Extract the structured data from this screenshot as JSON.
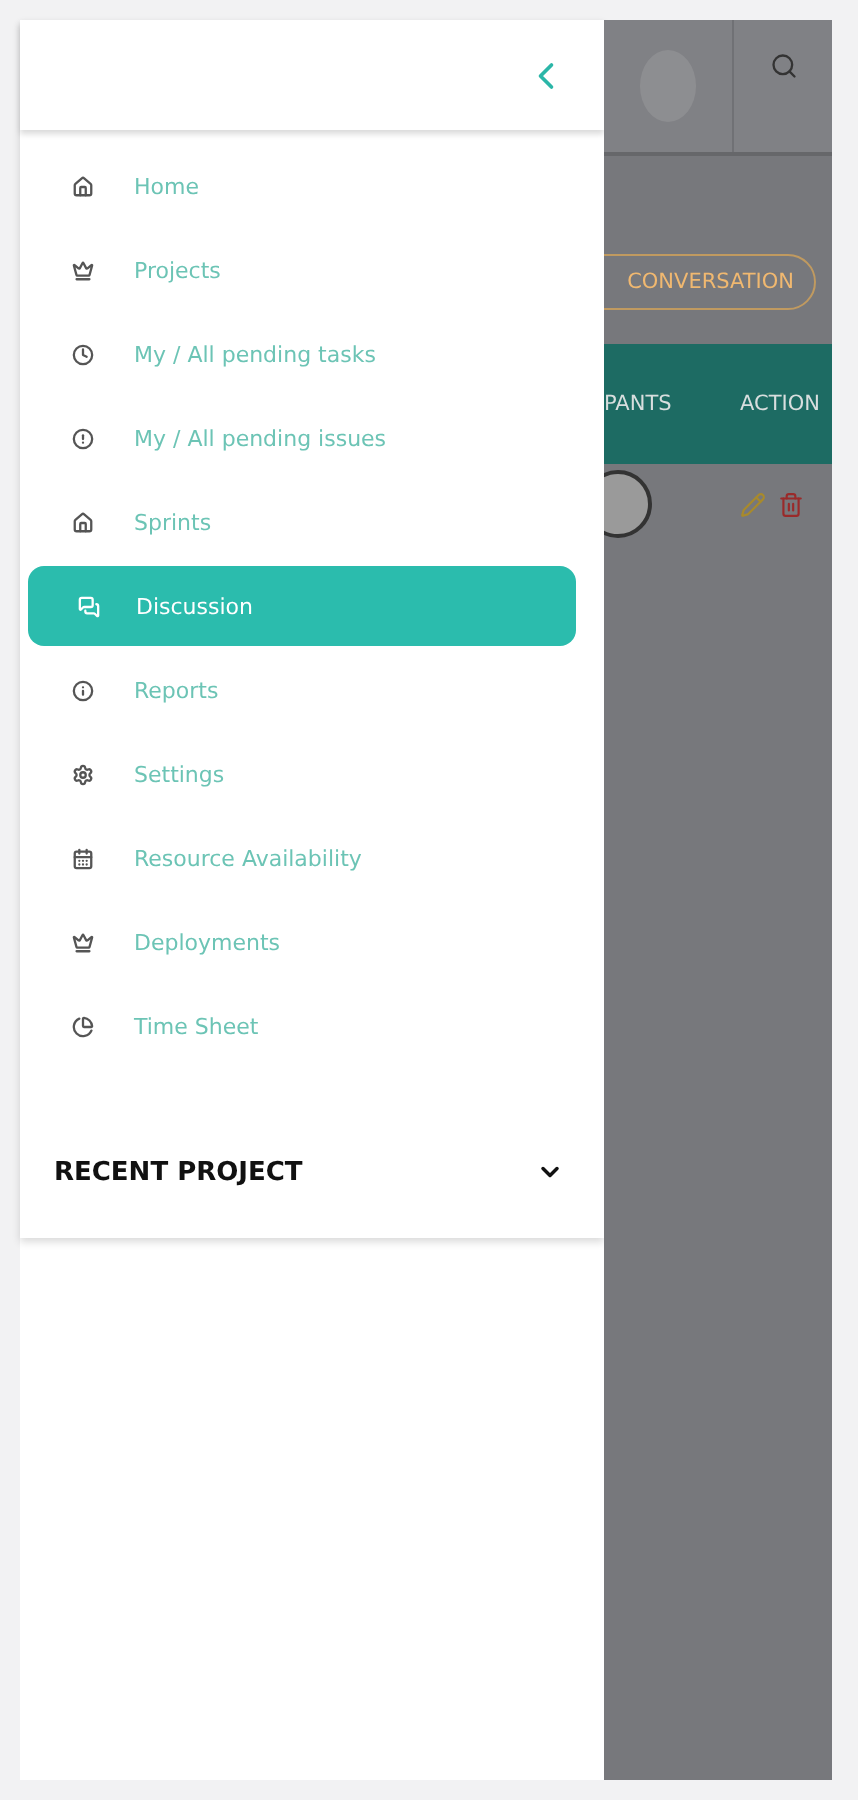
{
  "drawer": {
    "menu": [
      {
        "label": "Home",
        "selected": false
      },
      {
        "label": "Projects",
        "selected": false
      },
      {
        "label": "My / All pending tasks",
        "selected": false
      },
      {
        "label": "My / All pending issues",
        "selected": false
      },
      {
        "label": "Sprints",
        "selected": false
      },
      {
        "label": "Discussion",
        "selected": true
      },
      {
        "label": "Reports",
        "selected": false
      },
      {
        "label": "Settings",
        "selected": false
      },
      {
        "label": "Resource Availability",
        "selected": false
      },
      {
        "label": "Deployments",
        "selected": false
      },
      {
        "label": "Time Sheet",
        "selected": false
      }
    ],
    "recent_project": {
      "label": "RECENT PROJECT",
      "expanded": false
    }
  },
  "background": {
    "button": "CONVERSATION",
    "columns": [
      "PANTS",
      "ACTION"
    ]
  }
}
